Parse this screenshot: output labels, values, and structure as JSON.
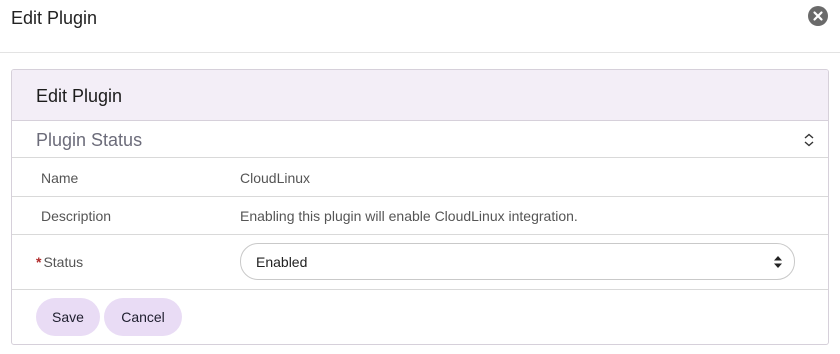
{
  "modal": {
    "title": "Edit Plugin"
  },
  "panel": {
    "title": "Edit Plugin",
    "section_title": "Plugin Status"
  },
  "fields": {
    "name_label": "Name",
    "name_value": "CloudLinux",
    "description_label": "Description",
    "description_value": "Enabling this plugin will enable CloudLinux integration.",
    "status_required_mark": "*",
    "status_label": "Status",
    "status_value": "Enabled"
  },
  "actions": {
    "save_label": "Save",
    "cancel_label": "Cancel"
  },
  "colors": {
    "panel_header_bg": "#f3eef7",
    "button_bg": "#e9dcf5",
    "required_mark": "#b02a2a"
  },
  "icons": {
    "close": "close-icon",
    "collapse": "collapse-icon",
    "select_arrows": "select-arrows-icon"
  }
}
